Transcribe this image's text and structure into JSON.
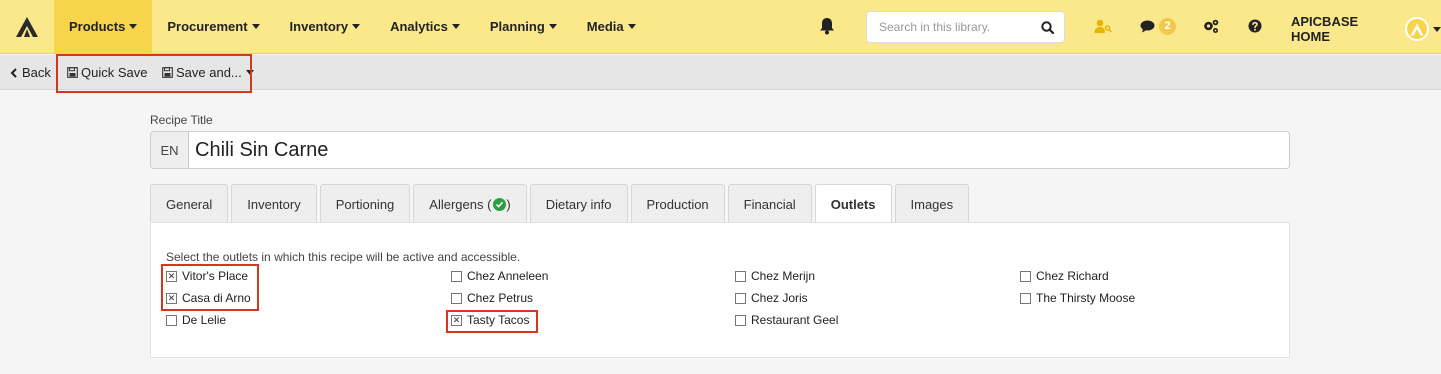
{
  "nav": {
    "items": [
      {
        "label": "Products",
        "active": true
      },
      {
        "label": "Procurement",
        "active": false
      },
      {
        "label": "Inventory",
        "active": false
      },
      {
        "label": "Analytics",
        "active": false
      },
      {
        "label": "Planning",
        "active": false
      },
      {
        "label": "Media",
        "active": false
      }
    ],
    "search_placeholder": "Search in this library.",
    "chat_count": "2",
    "home_label": "APICBASE HOME"
  },
  "toolbar": {
    "back_label": "Back",
    "quick_save_label": "Quick Save",
    "save_and_label": "Save and..."
  },
  "recipe": {
    "title_label": "Recipe Title",
    "lang": "EN",
    "title_value": "Chili Sin Carne"
  },
  "tabs": [
    {
      "label": "General"
    },
    {
      "label": "Inventory"
    },
    {
      "label": "Portioning"
    },
    {
      "label": "Allergens ("
    },
    {
      "label": "Dietary info"
    },
    {
      "label": "Production"
    },
    {
      "label": "Financial"
    },
    {
      "label": "Outlets"
    },
    {
      "label": "Images"
    }
  ],
  "tabs_allergens_close": ")",
  "outlets": {
    "intro": "Select the outlets in which this recipe will be active and accessible.",
    "items": [
      {
        "label": "Vitor's Place",
        "checked": true
      },
      {
        "label": "Casa di Arno",
        "checked": true
      },
      {
        "label": "De Lelie",
        "checked": false
      },
      {
        "label": "Chez Anneleen",
        "checked": false
      },
      {
        "label": "Chez Petrus",
        "checked": false
      },
      {
        "label": "Tasty Tacos",
        "checked": true
      },
      {
        "label": "Chez Merijn",
        "checked": false
      },
      {
        "label": "Chez Joris",
        "checked": false
      },
      {
        "label": "Restaurant Geel",
        "checked": false
      },
      {
        "label": "Chez Richard",
        "checked": false
      },
      {
        "label": "The Thirsty Moose",
        "checked": false
      }
    ]
  },
  "colors": {
    "nav_bg": "#fbe88b",
    "nav_active": "#f7d54a",
    "highlight_red": "#d9341f",
    "success_green": "#2aa043"
  }
}
